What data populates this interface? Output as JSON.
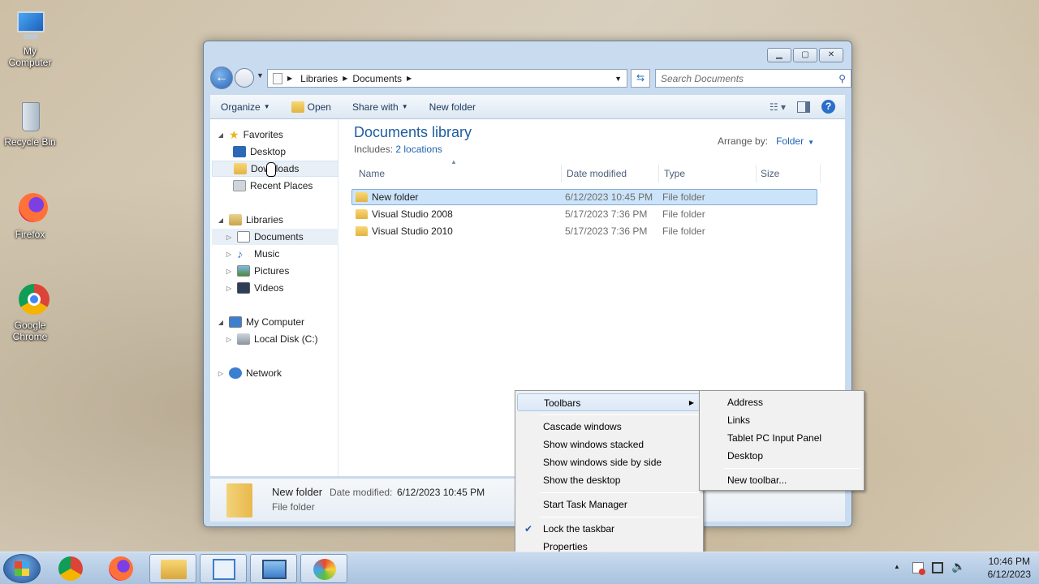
{
  "desktop": {
    "icons": [
      {
        "label": "My Computer",
        "icon": "computer-icon"
      },
      {
        "label": "Recycle Bin",
        "icon": "recycle-bin-icon"
      },
      {
        "label": "Firefox",
        "icon": "firefox-icon"
      },
      {
        "label": "Google Chrome",
        "icon": "chrome-icon"
      }
    ]
  },
  "window": {
    "breadcrumb": [
      "Libraries",
      "Documents"
    ],
    "search_placeholder": "Search Documents",
    "commands": {
      "organize": "Organize",
      "open": "Open",
      "share_with": "Share with",
      "new_folder": "New folder"
    },
    "nav": {
      "favorites": "Favorites",
      "desktop": "Desktop",
      "downloads": "Downloads",
      "recent": "Recent Places",
      "libraries": "Libraries",
      "documents": "Documents",
      "music": "Music",
      "pictures": "Pictures",
      "videos": "Videos",
      "my_computer": "My Computer",
      "local_disk": "Local Disk (C:)",
      "network": "Network"
    },
    "library_title": "Documents library",
    "includes_label": "Includes:",
    "includes_link": "2 locations",
    "arrange_label": "Arrange by:",
    "arrange_value": "Folder",
    "columns": {
      "name": "Name",
      "date": "Date modified",
      "type": "Type",
      "size": "Size"
    },
    "files": [
      {
        "name": "New folder",
        "date": "6/12/2023 10:45 PM",
        "type": "File folder"
      },
      {
        "name": "Visual Studio 2008",
        "date": "5/17/2023 7:36 PM",
        "type": "File folder"
      },
      {
        "name": "Visual Studio 2010",
        "date": "5/17/2023 7:36 PM",
        "type": "File folder"
      }
    ],
    "details": {
      "name": "New folder",
      "date_label": "Date modified:",
      "date": "6/12/2023 10:45 PM",
      "type": "File folder"
    }
  },
  "context_menu": {
    "toolbars": "Toolbars",
    "cascade": "Cascade windows",
    "stacked": "Show windows stacked",
    "side_by_side": "Show windows side by side",
    "show_desktop": "Show the desktop",
    "task_manager": "Start Task Manager",
    "lock_taskbar": "Lock the taskbar",
    "properties": "Properties"
  },
  "toolbars_submenu": {
    "address": "Address",
    "links": "Links",
    "tablet": "Tablet PC Input Panel",
    "desktop": "Desktop",
    "new_toolbar": "New toolbar..."
  },
  "taskbar": {
    "time": "10:46 PM",
    "date": "6/12/2023",
    "apps": [
      "chrome-icon",
      "firefox-icon",
      "explorer-icon",
      "control-panel-icon",
      "screenshot-icon",
      "paint-icon"
    ]
  }
}
